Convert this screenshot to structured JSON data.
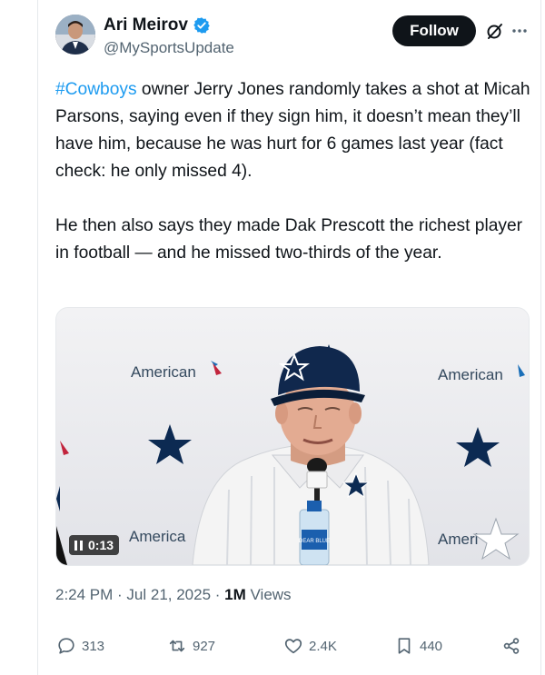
{
  "author": {
    "name": "Ari Meirov",
    "handle": "@MySportsUpdate",
    "verified": true
  },
  "header": {
    "follow_label": "Follow",
    "grok_icon": "grok-icon",
    "more_icon": "more-icon"
  },
  "tweet": {
    "hashtag": "#Cowboys",
    "text_part1": " owner Jerry Jones randomly takes a shot at Micah Parsons, saying even if they sign him, it doesn’t mean they’ll have him, because he was hurt for 6 games last year (fact check: he only missed 4).",
    "text_part2": "He then also says they made Dak Prescott the richest player in football — and he missed two-thirds of the year."
  },
  "media": {
    "type": "video",
    "duration": "0:13",
    "backdrop_text": "American",
    "backdrop_text_cut": "America",
    "backdrop_text_cut2": "Ameri",
    "bottle_label": "DEAR BLUE"
  },
  "meta": {
    "time": "2:24 PM",
    "separator": " · ",
    "date": "Jul 21, 2025",
    "views_count": "1M",
    "views_label": " Views"
  },
  "actions": {
    "replies": "313",
    "reposts": "927",
    "likes": "2.4K",
    "bookmarks": "440"
  },
  "colors": {
    "accent": "#1d9bf0",
    "text": "#0f1419",
    "secondary": "#536471",
    "cowboys_navy": "#0c2a52"
  }
}
